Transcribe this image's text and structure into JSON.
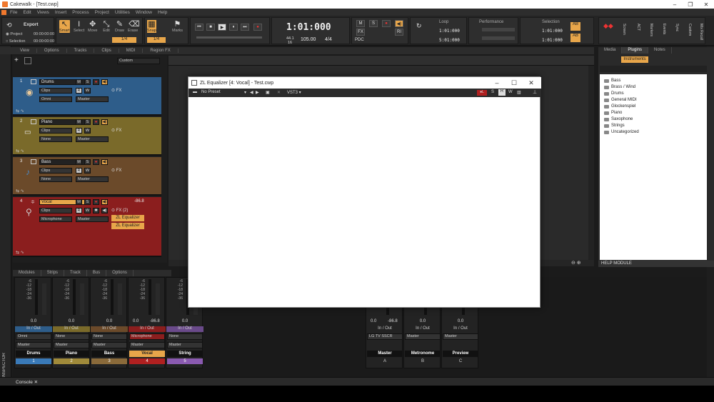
{
  "window": {
    "title": "Cakewalk - [Test.cwp]"
  },
  "menu": [
    "File",
    "Edit",
    "Views",
    "Insert",
    "Process",
    "Project",
    "Utilities",
    "Window",
    "Help"
  ],
  "control_bar": {
    "export_label": "Export",
    "project_label": "Project",
    "selection_label": "Selection",
    "project_time": "00:00:00:00",
    "selection_time": "00:00:00:00",
    "tools": [
      "Smart",
      "Select",
      "Move",
      "Edit",
      "Draw",
      "Erase"
    ],
    "snap_label": "Snap",
    "snap_value": "1/4",
    "marks_label": "Marks",
    "tool_value": "1/4",
    "time_display": "1:01:000",
    "sample_rate": "44.1",
    "bit_depth": "16",
    "tempo": "105.00",
    "meter": "4/4",
    "loop_label": "Loop",
    "loop_start": "1:01:000",
    "loop_end": "5:01:000",
    "performance_label": "Performance",
    "selection_label2": "Selection",
    "sel_start": "1:01:000",
    "sel_end": "1:01:000",
    "mix_buttons": [
      "M",
      "S",
      "PDC",
      "FX"
    ],
    "right_tabs": [
      "Screen",
      "ACT",
      "Markers",
      "Events",
      "Sync",
      "Custom",
      "Mix Recall"
    ]
  },
  "view_bar": [
    "View",
    "Options",
    "Tracks",
    "Clips",
    "MIDI",
    "Region FX"
  ],
  "custom_label": "Custom",
  "tracks": [
    {
      "num": "1",
      "name": "Drums",
      "clips": "Clips",
      "input": "Omni",
      "output": "Master",
      "fx": "FX",
      "color": "#2e5d8a",
      "icon": "drum-icon"
    },
    {
      "num": "2",
      "name": "Piano",
      "clips": "Clips",
      "input": "None",
      "output": "Master",
      "fx": "FX",
      "color": "#7a6a2a",
      "icon": "keyboard-icon"
    },
    {
      "num": "3",
      "name": "Bass",
      "clips": "Clips",
      "input": "None",
      "output": "Master",
      "fx": "FX",
      "color": "#6b4a2a",
      "icon": "guitar-icon"
    },
    {
      "num": "4",
      "name": "Vocal",
      "clips": "Clips",
      "input": "Microphone",
      "output": "Master",
      "fx": "FX (2)",
      "volume": "-86.8",
      "color": "#8b1e1e",
      "icon": "microphone-icon",
      "plugins": [
        "ZL Equalizer",
        "ZL Equalizer"
      ]
    }
  ],
  "browser": {
    "tabs": [
      "Media",
      "Plugins",
      "Notes"
    ],
    "active_subtab": "Instruments",
    "folders": [
      "Bass",
      "Brass / Wind",
      "Drums",
      "General MIDI",
      "Glockenspiel",
      "Piano",
      "Saxophone",
      "Strings",
      "Uncategorized"
    ],
    "help_label": "HELP MODULE"
  },
  "console_tabs": [
    "Modules",
    "Strips",
    "Track",
    "Bus",
    "Options"
  ],
  "strips": [
    {
      "name": "Drums",
      "num": "1",
      "val": "0.0",
      "io": "In / Out",
      "input": "Omni",
      "output": "Master",
      "color": "#3a7ab8"
    },
    {
      "name": "Piano",
      "num": "2",
      "val": "0.0",
      "io": "In / Out",
      "input": "None",
      "output": "Master",
      "color": "#a08a3a"
    },
    {
      "name": "Bass",
      "num": "3",
      "val": "0.0",
      "io": "In / Out",
      "input": "None",
      "output": "Master",
      "color": "#8a6a3a"
    },
    {
      "name": "Vocal",
      "num": "4",
      "val": "0.0",
      "val2": "-86.8",
      "io": "In / Out",
      "input": "Microphone",
      "output": "Master",
      "color": "#b02020"
    },
    {
      "name": "String",
      "num": "5",
      "val": "0.0",
      "io": "In / Out",
      "input": "None",
      "output": "Master",
      "color": "#8a5ab0"
    }
  ],
  "bus_strips": [
    {
      "name": "Master",
      "num": "A",
      "val": "0.0",
      "val2": "-86.8",
      "io": "In / Out",
      "output": "LG TV SSCR"
    },
    {
      "name": "Metronome",
      "num": "B",
      "val": "0.0",
      "io": "In / Out",
      "output": "Master"
    },
    {
      "name": "Preview",
      "num": "C",
      "val": "0.0",
      "io": "In / Out",
      "output": "Master"
    }
  ],
  "fader_scale": [
    "-6",
    "-12",
    "-18",
    "-24",
    "-36"
  ],
  "console_tab": "Console",
  "inspector_label": "INSPECTOR",
  "dialog": {
    "title": "ZL Equalizer [4: Vocal] - Test.cwp",
    "preset": "No Preset",
    "format": "VST3",
    "buttons": [
      "S",
      "R",
      "W"
    ]
  }
}
